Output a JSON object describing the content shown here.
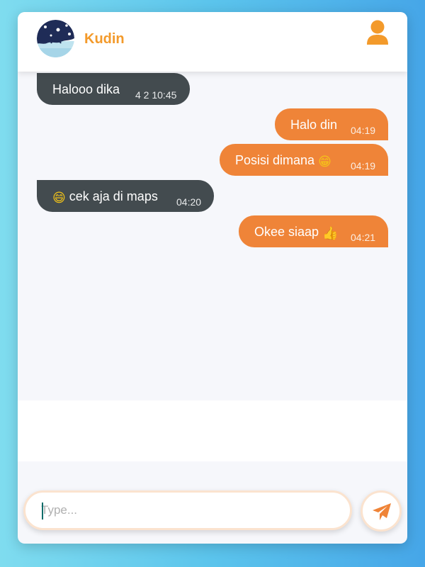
{
  "header": {
    "contact_name": "Kudin",
    "avatar_icon": "avatar-image",
    "profile_icon": "user-icon"
  },
  "messages": [
    {
      "direction": "incoming",
      "text": "Halooo dika",
      "emoji": "",
      "time": "4 2 10:45"
    },
    {
      "direction": "outgoing",
      "text": "Halo din",
      "emoji": "",
      "time": "04:19"
    },
    {
      "direction": "outgoing",
      "text": "Posisi dimana ",
      "emoji": "😁",
      "time": "04:19"
    },
    {
      "direction": "incoming",
      "text": " cek aja di maps",
      "emoji": "😄",
      "time": "04:20"
    },
    {
      "direction": "outgoing",
      "text": "Okee siaap ",
      "emoji": "👍",
      "time": "04:21"
    }
  ],
  "composer": {
    "placeholder": "Type...",
    "value": "",
    "send_icon": "paper-plane-icon"
  },
  "colors": {
    "accent": "#f39a2b",
    "outgoing_bubble": "#ef8438",
    "incoming_bubble": "#434b4f",
    "background_start": "#7fdcef",
    "background_end": "#46a6e8"
  }
}
